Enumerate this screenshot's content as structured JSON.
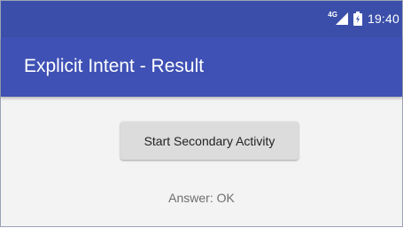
{
  "status_bar": {
    "network_type": "4G",
    "signal_icon": "signal-strength-icon",
    "battery_icon": "battery-icon",
    "time": "19:40",
    "colors": {
      "background": "#3b4faa",
      "foreground": "#ffffff"
    }
  },
  "app_bar": {
    "title": "Explicit Intent - Result",
    "color": "#3f51b5"
  },
  "main": {
    "start_button_label": "Start Secondary Activity",
    "answer_text": "Answer: OK"
  }
}
